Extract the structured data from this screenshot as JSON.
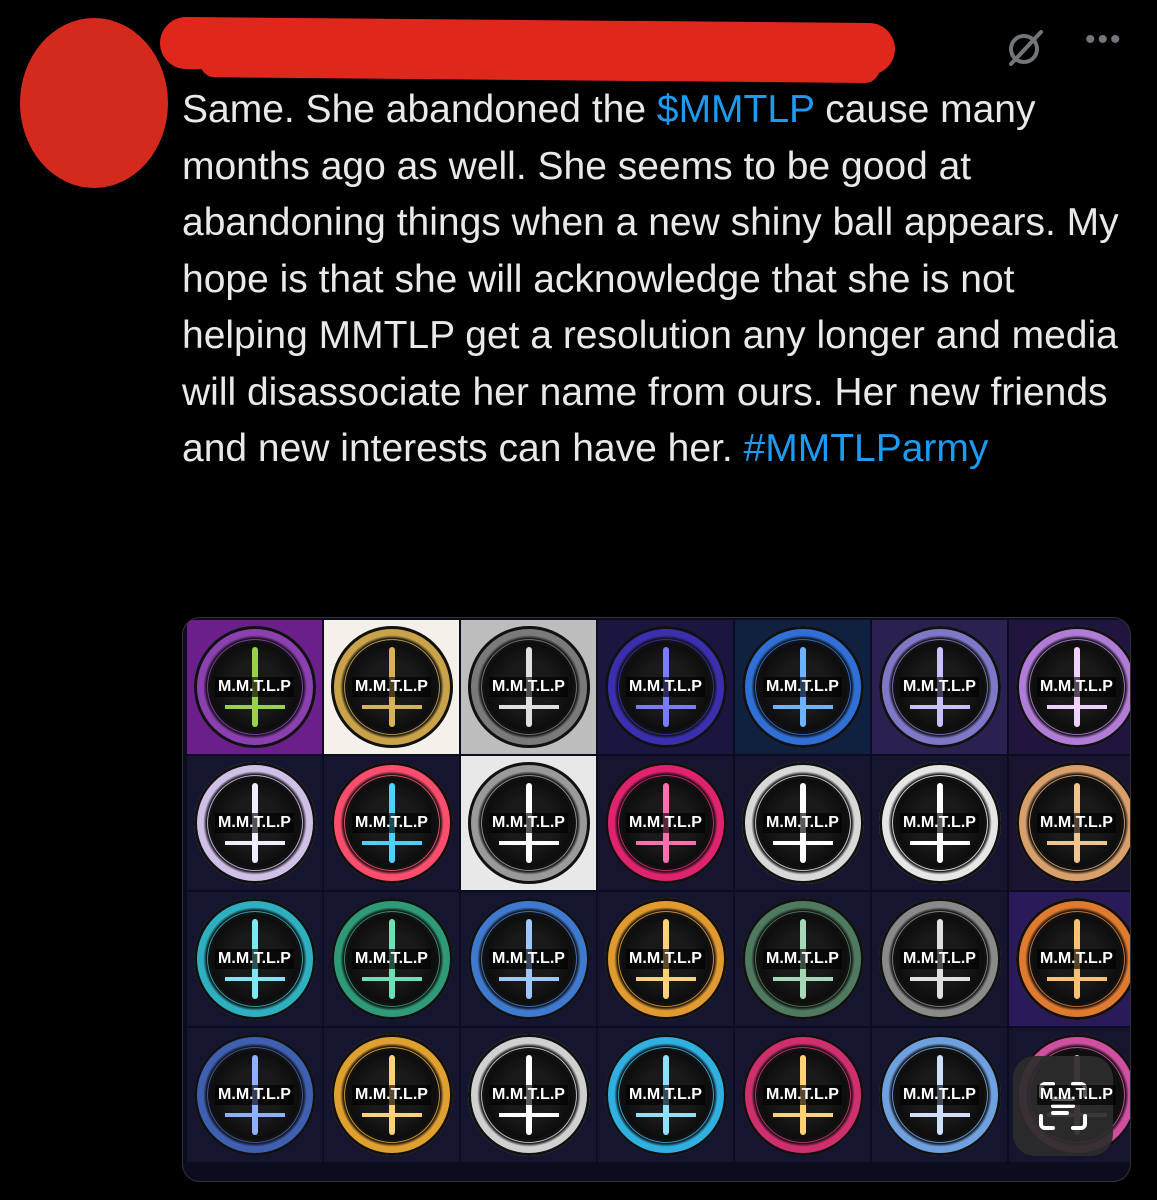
{
  "tweet": {
    "text_parts": [
      "Same. She abandoned the ",
      "$MMTLP",
      " cause many months ago as well. She seems to be good at abandoning things when a new shiny ball appears. My hope is that she will acknowledge that she is not helping MMTLP get a resolution any longer and media will disassociate her name from ours. Her new friends and new interests can have her. ",
      "#MMTLParmy"
    ],
    "cashtag": "$MMTLP",
    "hashtag": "#MMTLParmy"
  },
  "icons": {
    "grok": "grok-icon",
    "more": "more-icon",
    "lens": "visual-search-icon"
  },
  "media": {
    "tiles": [
      {
        "label": "M.M.T.L.P",
        "bg": "#6a1f8a",
        "ring": "#8b3fb0",
        "accent": "#9ad14b"
      },
      {
        "label": "M.M.T.L.P",
        "bg": "#f4f1ea",
        "ring": "#c9a24a",
        "accent": "#d8b25a"
      },
      {
        "label": "M.M.T.L.P",
        "bg": "#bdbdbd",
        "ring": "#7a7a7a",
        "accent": "#e0e0e0"
      },
      {
        "label": "M.M.T.L.P",
        "bg": "#1a1640",
        "ring": "#3b2fb0",
        "accent": "#7a7cff"
      },
      {
        "label": "M.M.T.L.P",
        "bg": "#10213f",
        "ring": "#2f6fd6",
        "accent": "#6fb2ff"
      },
      {
        "label": "M.M.T.L.P",
        "bg": "#2a2150",
        "ring": "#7f78c8",
        "accent": "#c7c1ff"
      },
      {
        "label": "M.M.T.L.P",
        "bg": "#20153f",
        "ring": "#b07cd8",
        "accent": "#f0d0ff"
      },
      {
        "label": "M.M.T.L.P",
        "bg": "#151530",
        "ring": "#cfc0e8",
        "accent": "#f2ecff"
      },
      {
        "label": "M.M.T.L.P",
        "bg": "#151530",
        "ring": "#ff4d6d",
        "accent": "#4dd2ff"
      },
      {
        "label": "M.M.T.L.P",
        "bg": "#e8e8e8",
        "ring": "#9a9a9a",
        "accent": "#ffffff"
      },
      {
        "label": "M.M.T.L.P",
        "bg": "#151530",
        "ring": "#e0226f",
        "accent": "#ff6fae"
      },
      {
        "label": "M.M.T.L.P",
        "bg": "#151530",
        "ring": "#d8d8d8",
        "accent": "#ffffff"
      },
      {
        "label": "M.M.T.L.P",
        "bg": "#151530",
        "ring": "#e6e6e6",
        "accent": "#ffffff"
      },
      {
        "label": "M.M.T.L.P",
        "bg": "#1a1430",
        "ring": "#d9a06b",
        "accent": "#f2c38c"
      },
      {
        "label": "M.M.T.L.P",
        "bg": "#151530",
        "ring": "#2fb0c0",
        "accent": "#7fe7f2"
      },
      {
        "label": "M.M.T.L.P",
        "bg": "#151530",
        "ring": "#2f9a7a",
        "accent": "#6fe0b5"
      },
      {
        "label": "M.M.T.L.P",
        "bg": "#151530",
        "ring": "#3f7ad0",
        "accent": "#9fc7ff"
      },
      {
        "label": "M.M.T.L.P",
        "bg": "#151530",
        "ring": "#e09a2f",
        "accent": "#ffd27a"
      },
      {
        "label": "M.M.T.L.P",
        "bg": "#151530",
        "ring": "#4f7a5f",
        "accent": "#a7d8b5"
      },
      {
        "label": "M.M.T.L.P",
        "bg": "#151530",
        "ring": "#8a8a8a",
        "accent": "#e0e0e0"
      },
      {
        "label": "M.M.T.L.P",
        "bg": "#2a1a5a",
        "ring": "#e07a2f",
        "accent": "#ffc06f"
      },
      {
        "label": "M.M.T.L.P",
        "bg": "#151530",
        "ring": "#3f5fb0",
        "accent": "#8fb0ff"
      },
      {
        "label": "M.M.T.L.P",
        "bg": "#151530",
        "ring": "#e0a02f",
        "accent": "#ffd27a"
      },
      {
        "label": "M.M.T.L.P",
        "bg": "#151530",
        "ring": "#d0d0d0",
        "accent": "#ffffff"
      },
      {
        "label": "M.M.T.L.P",
        "bg": "#151530",
        "ring": "#2fb0e0",
        "accent": "#8fe0ff"
      },
      {
        "label": "M.M.T.L.P",
        "bg": "#151530",
        "ring": "#d02f6f",
        "accent": "#ffd27a"
      },
      {
        "label": "M.M.T.L.P",
        "bg": "#151530",
        "ring": "#6fa0e0",
        "accent": "#cfe0ff"
      },
      {
        "label": "M.M.T.L.P",
        "bg": "#151530",
        "ring": "#d04fa0",
        "accent": "#ffb0e0"
      }
    ]
  }
}
